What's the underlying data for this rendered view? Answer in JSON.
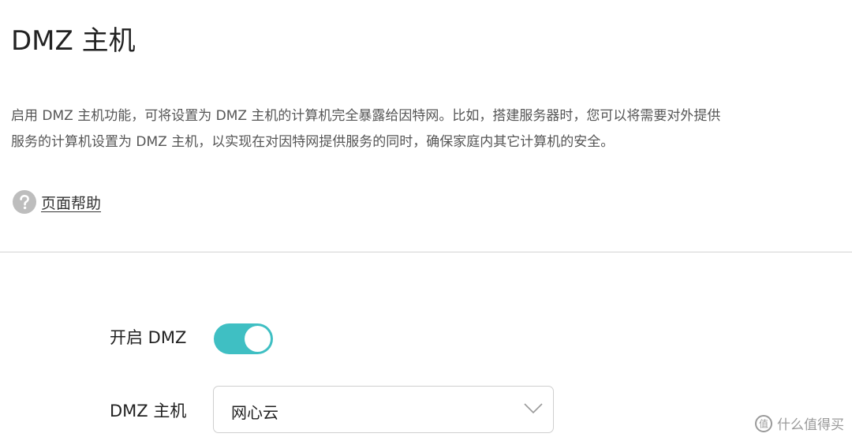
{
  "page": {
    "title": "DMZ 主机",
    "description_line1": "启用 DMZ 主机功能，可将设置为 DMZ 主机的计算机完全暴露给因特网。比如，搭建服务器时，您可以将需要对外提供",
    "description_line2": "服务的计算机设置为 DMZ 主机，以实现在对因特网提供服务的同时，确保家庭内其它计算机的安全。",
    "help_link": "页面帮助",
    "help_icon": "question-circle-icon"
  },
  "form": {
    "enable_label": "开启 DMZ",
    "enable_on": true,
    "host_label": "DMZ 主机",
    "host_value": "网心云",
    "host_dropdown_icon": "chevron-down-icon"
  },
  "watermark": {
    "text": "什么值得买"
  },
  "colors": {
    "toggle_on": "#3fbfc3",
    "divider": "#d4d4d4",
    "help_icon": "#bdbdbd"
  }
}
